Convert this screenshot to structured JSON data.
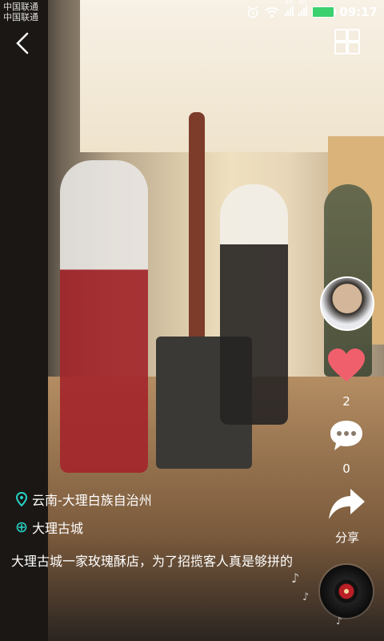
{
  "status_bar": {
    "carrier_lines": [
      "中国联通",
      "中国联通"
    ],
    "network_labels": [
      "4G",
      "3G"
    ],
    "time": "09:17"
  },
  "location": {
    "region": "云南-大理白族自治州",
    "place": "大理古城"
  },
  "post": {
    "caption": "大理古城一家玫瑰酥店，为了招揽客人真是够拼的"
  },
  "actions": {
    "like_count": "2",
    "comment_count": "0",
    "share_label": "分享"
  },
  "colors": {
    "like_heart": "#f0606c",
    "location_icon": "#27d3c6",
    "battery": "#3bd16f"
  },
  "icons": [
    "back-arrow-icon",
    "grid-icon",
    "location-pin-icon",
    "location-target-icon",
    "heart-icon",
    "comment-icon",
    "share-icon",
    "music-record-icon",
    "music-note-icon",
    "alarm-icon",
    "wifi-icon",
    "signal-icon",
    "battery-icon"
  ]
}
